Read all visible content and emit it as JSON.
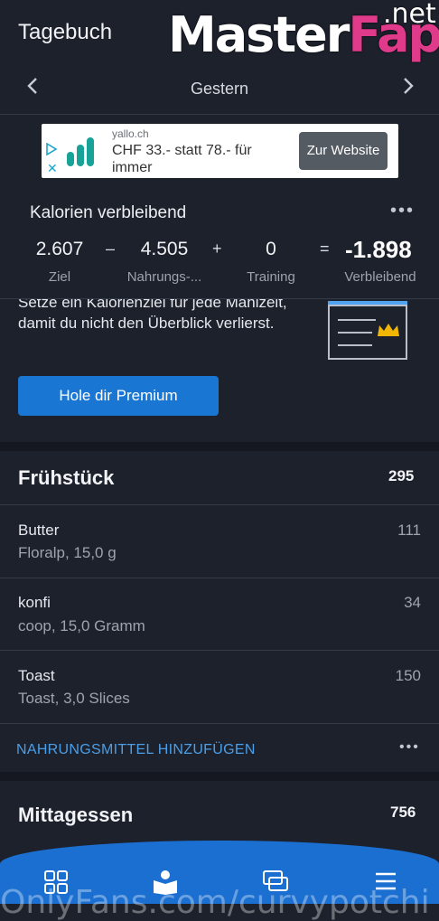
{
  "header": {
    "title": "Tagebuch"
  },
  "watermark": {
    "brand_main": "Master",
    "brand_accent": "Fap",
    "brand_tld": ".net",
    "footer": "OnlyFans.com/curvypotchi"
  },
  "date_nav": {
    "label": "Gestern",
    "prev_icon": "chevron-left-icon",
    "next_icon": "chevron-right-icon"
  },
  "ad": {
    "domain": "yallo.ch",
    "text": "CHF 33.- statt 78.- für immer",
    "button_label": "Zur Website"
  },
  "calories": {
    "heading": "Kalorien verbleibend",
    "goal": {
      "value": "2.607",
      "label": "Ziel"
    },
    "food": {
      "value": "4.505",
      "label": "Nahrungs-..."
    },
    "exercise": {
      "value": "0",
      "label": "Training"
    },
    "remaining": {
      "value": "-1.898",
      "label": "Verbleibend"
    },
    "op_minus": "–",
    "op_plus": "+",
    "op_equals": "="
  },
  "promo": {
    "text": "Setze ein Kalorienziel für jede Mahlzeit, damit du nicht den Überblick verlierst.",
    "button_label": "Hole dir Premium"
  },
  "breakfast": {
    "title": "Frühstück",
    "total": "295",
    "items": [
      {
        "name": "Butter",
        "detail": "Floralp, 15,0 g",
        "calories": "111"
      },
      {
        "name": "konfi",
        "detail": "coop, 15,0 Gramm",
        "calories": "34"
      },
      {
        "name": "Toast",
        "detail": "Toast, 3,0 Slices",
        "calories": "150"
      }
    ],
    "add_label": "NAHRUNGSMITTEL HINZUFÜGEN"
  },
  "lunch": {
    "title": "Mittagessen",
    "total": "756"
  },
  "colors": {
    "background": "#1d212c",
    "accent": "#1976d2",
    "link": "#4a9ee8"
  }
}
